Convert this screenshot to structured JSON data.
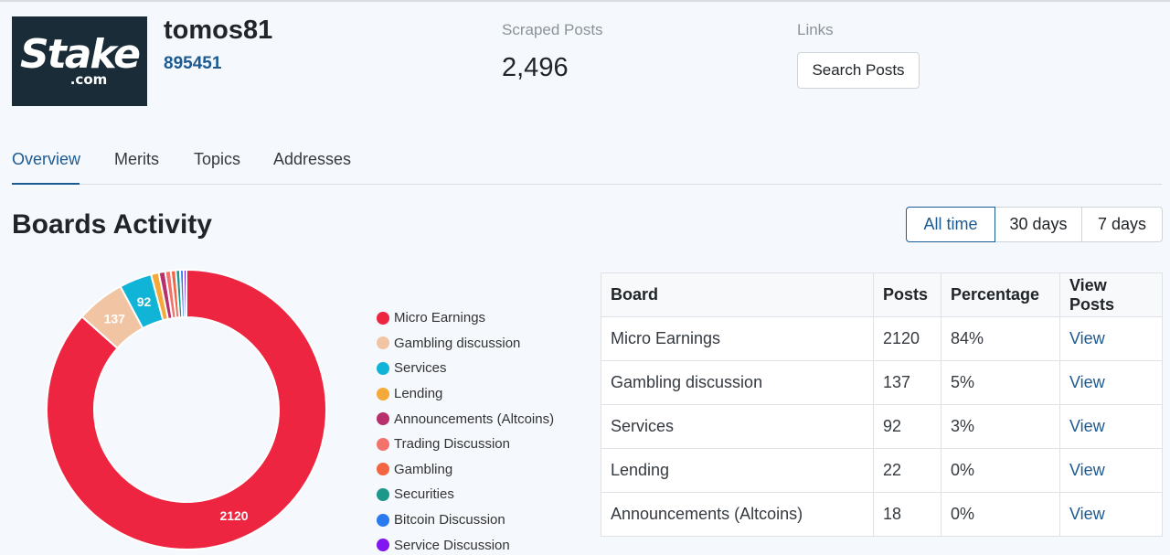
{
  "profile": {
    "logo_word": "Stake",
    "logo_suffix": ".com",
    "username": "tomos81",
    "user_id": "895451"
  },
  "stats": {
    "scraped_label": "Scraped Posts",
    "scraped_value": "2,496",
    "links_label": "Links",
    "search_button": "Search Posts"
  },
  "tabs": [
    {
      "label": "Overview",
      "active": true
    },
    {
      "label": "Merits",
      "active": false
    },
    {
      "label": "Topics",
      "active": false
    },
    {
      "label": "Addresses",
      "active": false
    }
  ],
  "section": {
    "title": "Boards Activity"
  },
  "range": {
    "options": [
      "All time",
      "30 days",
      "7 days"
    ],
    "selected": "All time"
  },
  "chart_data": {
    "type": "pie",
    "categories": [
      "Micro Earnings",
      "Gambling discussion",
      "Services",
      "Lending",
      "Announcements (Altcoins)",
      "Trading Discussion",
      "Gambling",
      "Securities",
      "Bitcoin Discussion",
      "Service Discussion"
    ],
    "values": [
      2120,
      137,
      92,
      22,
      18,
      16,
      14,
      12,
      10,
      8
    ],
    "labels_shown": [
      "2120",
      "137",
      "92"
    ],
    "colors": [
      "#ee2540",
      "#f1c5a3",
      "#0fb4d6",
      "#f5a93a",
      "#b7306c",
      "#f4726c",
      "#f26543",
      "#1e978b",
      "#2979ef",
      "#8216f0"
    ],
    "legend_position": "right"
  },
  "table": {
    "headers": [
      "Board",
      "Posts",
      "Percentage",
      "View Posts"
    ],
    "rows": [
      {
        "board": "Micro Earnings",
        "posts": "2120",
        "pct": "84%",
        "view": "View"
      },
      {
        "board": "Gambling discussion",
        "posts": "137",
        "pct": "5%",
        "view": "View"
      },
      {
        "board": "Services",
        "posts": "92",
        "pct": "3%",
        "view": "View"
      },
      {
        "board": "Lending",
        "posts": "22",
        "pct": "0%",
        "view": "View"
      },
      {
        "board": "Announcements (Altcoins)",
        "posts": "18",
        "pct": "0%",
        "view": "View"
      }
    ]
  }
}
